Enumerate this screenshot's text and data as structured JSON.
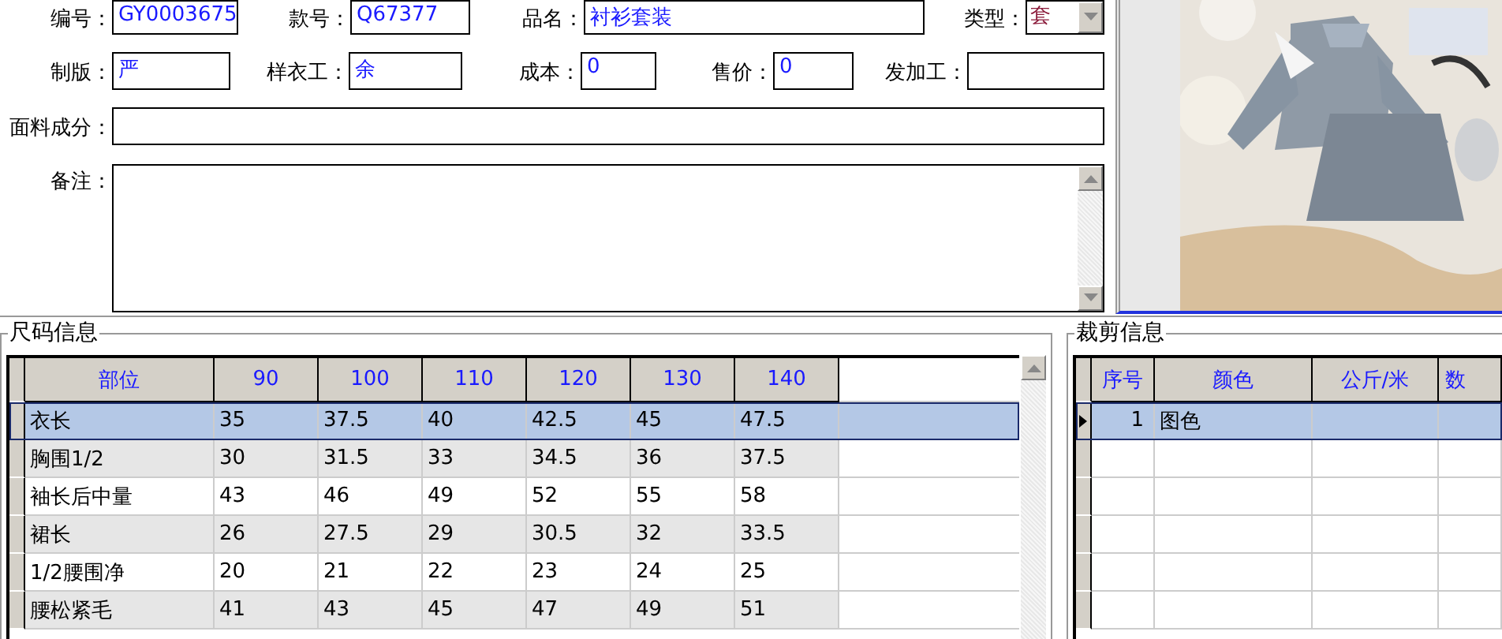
{
  "form": {
    "rows": [
      [
        {
          "label": "编号：",
          "value": "GY0003675",
          "kind": "text"
        },
        {
          "label": "款号：",
          "value": "Q67377",
          "kind": "text"
        },
        {
          "label": "品名：",
          "value": "衬衫套装",
          "kind": "text"
        },
        {
          "label": "类型：",
          "value": "套",
          "kind": "combo"
        }
      ],
      [
        {
          "label": "制版：",
          "value": "严",
          "kind": "text"
        },
        {
          "label": "样衣工：",
          "value": "余",
          "kind": "text"
        },
        {
          "label": "成本：",
          "value": "0",
          "kind": "text"
        },
        {
          "label": "售价：",
          "value": "0",
          "kind": "text"
        },
        {
          "label": "发加工：",
          "kind": "text"
        }
      ],
      [
        {
          "label": "面料成分：",
          "kind": "text"
        }
      ],
      [
        {
          "label": "备注：",
          "kind": "memo"
        }
      ]
    ]
  },
  "size_table": {
    "title": "尺码信息",
    "columns": [
      "部位",
      "90",
      "100",
      "110",
      "120",
      "130",
      "140"
    ],
    "rows": [
      {
        "cells": [
          "衣长",
          "35",
          "37.5",
          "40",
          "42.5",
          "45",
          "47.5"
        ],
        "selected": true
      },
      {
        "cells": [
          "胸围1/2",
          "30",
          "31.5",
          "33",
          "34.5",
          "36",
          "37.5"
        ],
        "selected": false
      },
      {
        "cells": [
          "袖长后中量",
          "43",
          "46",
          "49",
          "52",
          "55",
          "58"
        ],
        "selected": false
      },
      {
        "cells": [
          "裙长",
          "26",
          "27.5",
          "29",
          "30.5",
          "32",
          "33.5"
        ],
        "selected": false
      },
      {
        "cells": [
          "1/2腰围净",
          "20",
          "21",
          "22",
          "23",
          "24",
          "25"
        ],
        "selected": false
      },
      {
        "cells": [
          "腰松紧毛",
          "41",
          "43",
          "45",
          "47",
          "49",
          "51"
        ],
        "selected": false
      }
    ]
  },
  "cut_table": {
    "title": "裁剪信息",
    "columns": [
      "序号",
      "颜色",
      "公斤/米",
      "数"
    ],
    "rows": [
      {
        "cells": [
          "1",
          "图色",
          "",
          ""
        ],
        "selected": true
      }
    ]
  }
}
